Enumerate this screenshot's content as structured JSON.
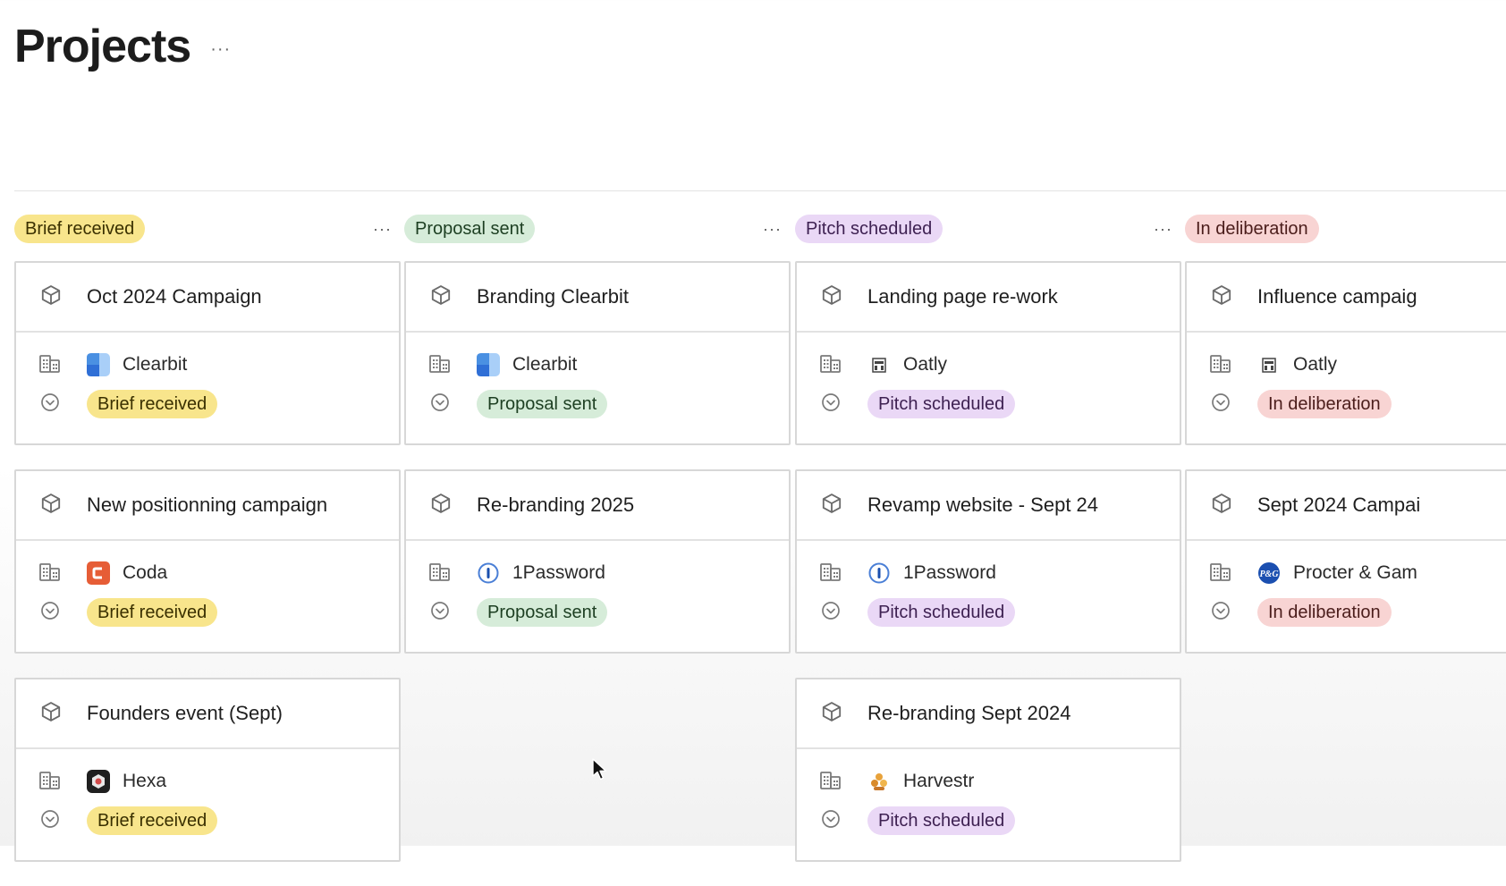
{
  "page": {
    "title": "Projects",
    "more": "···"
  },
  "colors": {
    "yellow_bg": "#f8e58c",
    "yellow_fg": "#3a3000",
    "green_bg": "#d6ecd9",
    "green_fg": "#1d3f22",
    "purple_bg": "#ead8f6",
    "purple_fg": "#3e2152",
    "red_bg": "#f8d4d3",
    "red_fg": "#4b1d1b"
  },
  "columns": [
    {
      "label": "Brief received",
      "color": "yellow",
      "more": "···",
      "cards": [
        {
          "title": "Oct 2024 Campaign",
          "company": "Clearbit",
          "logo": "clearbit-logo",
          "status": "Brief received"
        },
        {
          "title": "New positionning campaign",
          "company": "Coda",
          "logo": "coda-logo",
          "status": "Brief received"
        },
        {
          "title": "Founders event (Sept)",
          "company": "Hexa",
          "logo": "hexa-logo",
          "status": "Brief received"
        }
      ]
    },
    {
      "label": "Proposal sent",
      "color": "green",
      "more": "···",
      "cards": [
        {
          "title": "Branding Clearbit",
          "company": "Clearbit",
          "logo": "clearbit-logo",
          "status": "Proposal sent"
        },
        {
          "title": "Re-branding 2025",
          "company": "1Password",
          "logo": "1password-logo",
          "status": "Proposal sent"
        }
      ]
    },
    {
      "label": "Pitch scheduled",
      "color": "purple",
      "more": "···",
      "cards": [
        {
          "title": "Landing page re-work",
          "company": "Oatly",
          "logo": "oatly-logo",
          "status": "Pitch scheduled"
        },
        {
          "title": "Revamp website - Sept 24",
          "company": "1Password",
          "logo": "1password-logo",
          "status": "Pitch scheduled"
        },
        {
          "title": "Re-branding Sept 2024",
          "company": "Harvestr",
          "logo": "harvestr-logo",
          "status": "Pitch scheduled"
        }
      ]
    },
    {
      "label": "In deliberation",
      "color": "red",
      "more": "",
      "cards": [
        {
          "title": "Influence campaig",
          "company": "Oatly",
          "logo": "oatly-logo",
          "status": "In deliberation"
        },
        {
          "title": "Sept 2024 Campai",
          "company": "Procter & Gam",
          "logo": "pg-logo",
          "status": "In deliberation"
        }
      ]
    }
  ]
}
